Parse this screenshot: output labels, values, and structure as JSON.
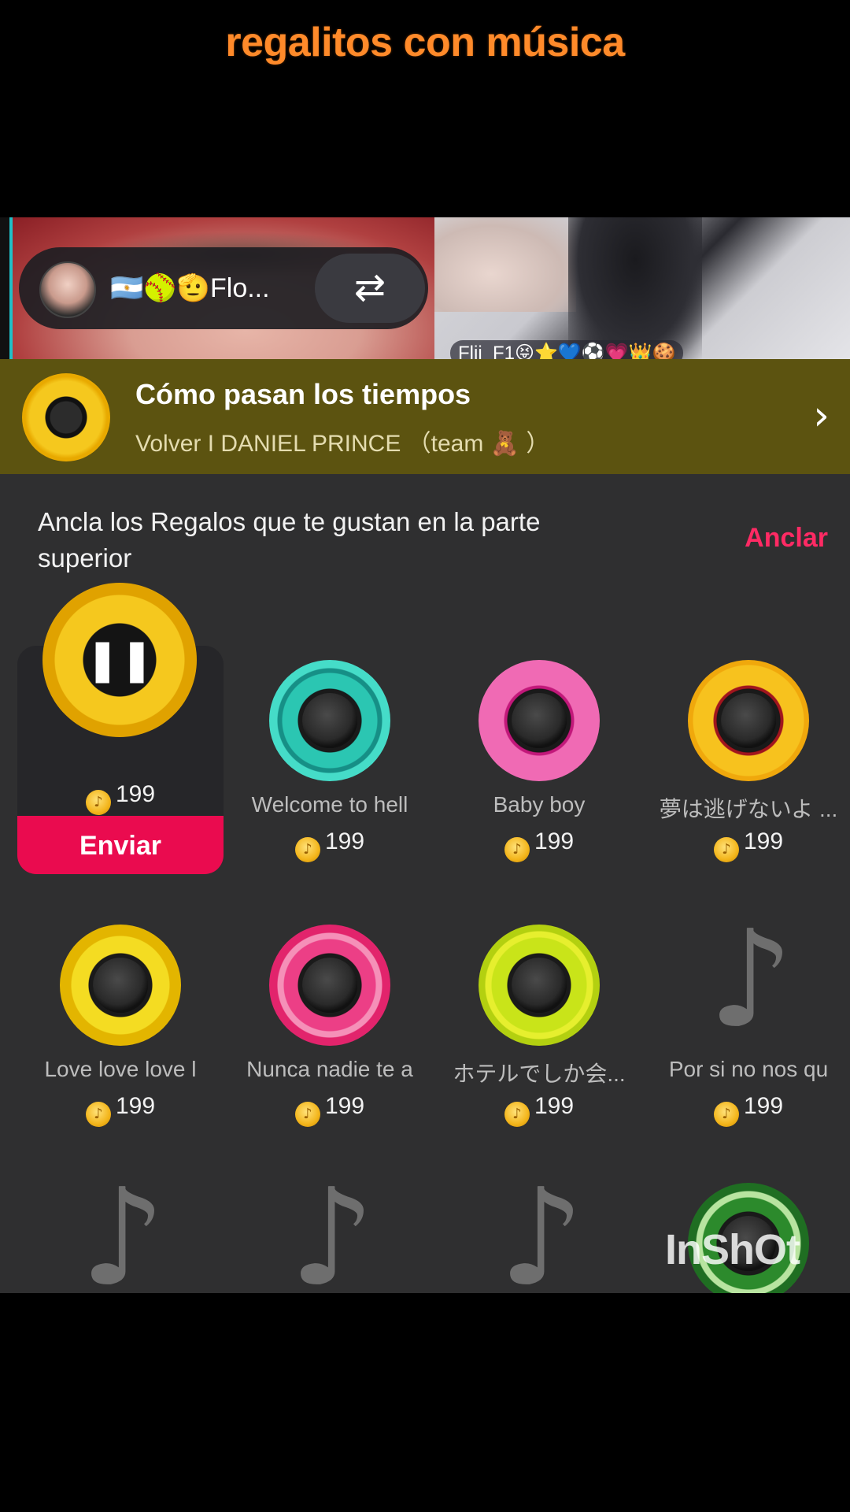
{
  "caption": "regalitos con música",
  "live": {
    "host_name": "🇦🇷🥎🫡Flo...",
    "swap_icon": "⇄",
    "guest_name": "Flii_F1😝⭐💙⚽💗👑🍪"
  },
  "now_playing": {
    "title": "Cómo pasan los tiempos",
    "subtitle": "Volver I DANIEL PRINCE （team 🧸 ）",
    "chevron": "›"
  },
  "gift_panel": {
    "hint": "Ancla los Regalos que te gustan en la parte superior",
    "pin_label": "Anclar",
    "selected": {
      "price": "199",
      "send_label": "Enviar",
      "pause_glyph": "❚❚"
    },
    "gifts": [
      {
        "name": "Welcome to hell",
        "price": "199",
        "color": "#2bc6b2"
      },
      {
        "name": "Baby boy",
        "price": "199",
        "color": "#f06ab4"
      },
      {
        "name": "夢は逃げないよ ...",
        "price": "199",
        "color": "#f7c21e"
      },
      {
        "name": "Love love love l",
        "price": "199",
        "color": "#f4dc22"
      },
      {
        "name": "Nunca nadie te a",
        "price": "199",
        "color": "#ec3f86"
      },
      {
        "name": "ホテルでしか会...",
        "price": "199",
        "color": "#c9e419"
      },
      {
        "name": "Por si no nos qu",
        "price": "199",
        "color": "placeholder"
      }
    ],
    "coin_glyph": "♪",
    "placeholder_glyph": "♪"
  },
  "watermark": "InShOt"
}
